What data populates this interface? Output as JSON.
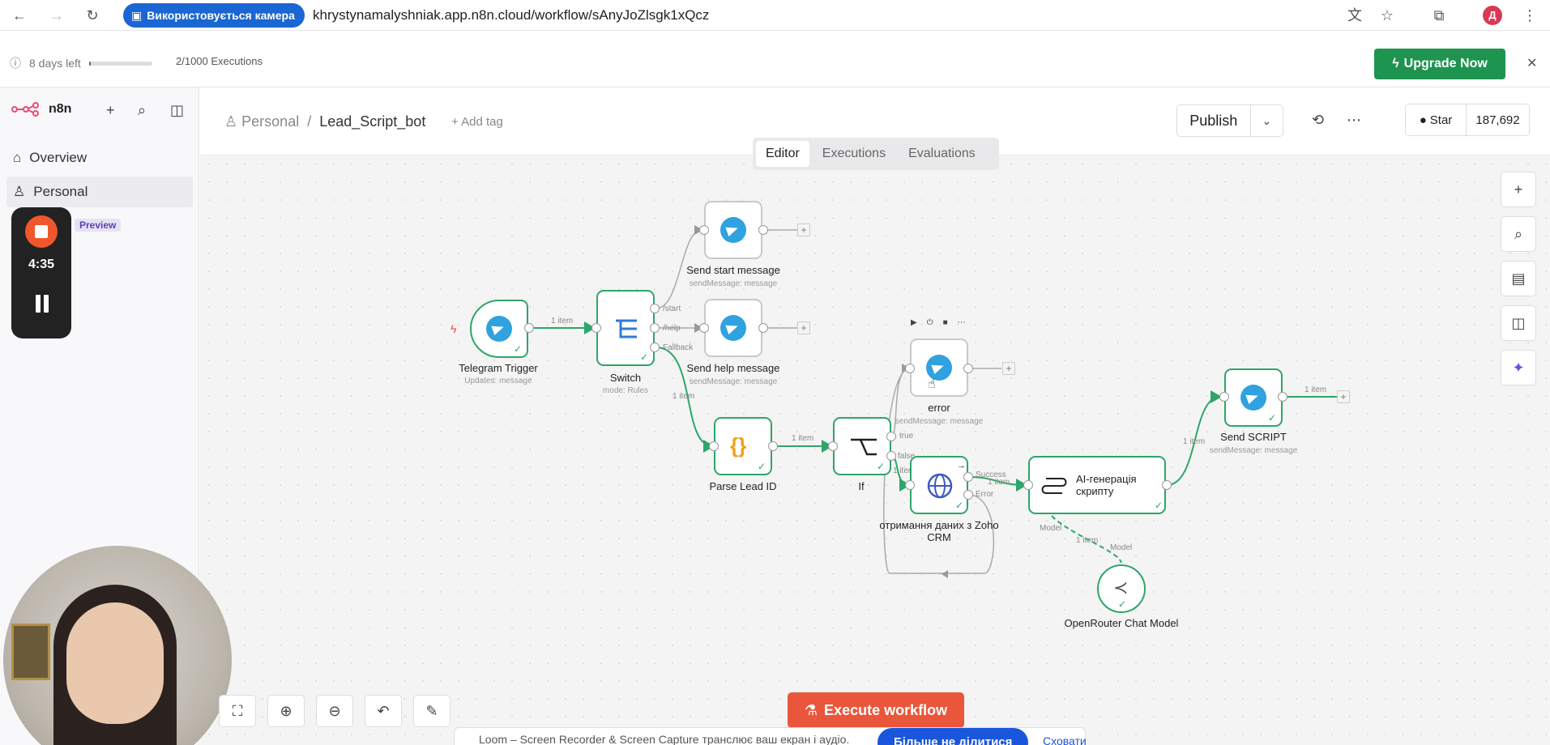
{
  "browser": {
    "camera_pill": "Використовується камера",
    "url": "khrystynamalyshniak.app.n8n.cloud/workflow/sAnyJoZlsgk1xQcz",
    "profile_initial": "Д"
  },
  "trial": {
    "days_left": "8 days left",
    "progress_fraction": 0.03,
    "executions": "2/1000 Executions",
    "upgrade_label": "Upgrade Now"
  },
  "sidebar": {
    "logo": "n8n",
    "items": [
      {
        "label": "Overview"
      },
      {
        "label": "Personal"
      }
    ],
    "preview_badge": "Preview"
  },
  "recorder": {
    "time": "4:35"
  },
  "header": {
    "breadcrumb_project": "Personal",
    "breadcrumb_separator": "/",
    "workflow_name": "Lead_Script_bot",
    "add_tag": "+ Add tag",
    "publish_label": "Publish",
    "github_star": "Star",
    "github_count": "187,692"
  },
  "tabs": [
    {
      "label": "Editor",
      "active": true
    },
    {
      "label": "Executions",
      "active": false
    },
    {
      "label": "Evaluations",
      "active": false
    }
  ],
  "nodes": {
    "telegram_trigger": {
      "label": "Telegram Trigger",
      "sub": "Updates: message"
    },
    "switch": {
      "label": "Switch",
      "sub": "mode: Rules"
    },
    "send_start": {
      "label": "Send start message",
      "sub": "sendMessage: message"
    },
    "send_help": {
      "label": "Send help message",
      "sub": "sendMessage: message"
    },
    "parse_lead": {
      "label": "Parse Lead ID"
    },
    "if_node": {
      "label": "If"
    },
    "error": {
      "label": "error",
      "sub": "sendMessage: message"
    },
    "zoho": {
      "label": "отримання даних з Zoho CRM"
    },
    "ai": {
      "label": "AI-генерація скрипту"
    },
    "send_script": {
      "label": "Send SCRIPT",
      "sub": "sendMessage: message"
    },
    "openrouter": {
      "label": "OpenRouter Chat Model"
    }
  },
  "connections": {
    "trigger_switch": "1 item",
    "switch_start": "/start",
    "switch_help": "/help",
    "switch_fallback": "Fallback",
    "fallback_item": "1 item",
    "parse_if": "1 item",
    "if_true": "true",
    "if_false": "false",
    "if_item": "1 item",
    "zoho_success": "Success",
    "zoho_error": "Error",
    "zoho_ai_item": "1 item",
    "ai_send_item": "1 item",
    "send_out_item": "1 item",
    "model_port": "Model",
    "model_item": "1 item",
    "model_label": "Model"
  },
  "execute_label": "Execute workflow",
  "loom": {
    "text": "Loom – Screen Recorder & Screen Capture транслює ваш екран і аудіо.",
    "button": "Більше не ділитися",
    "link": "Сховати"
  }
}
